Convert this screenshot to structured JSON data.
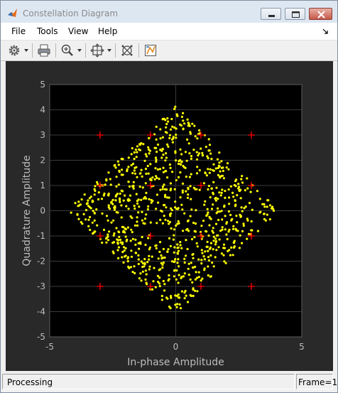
{
  "window": {
    "title": "Constellation Diagram",
    "icons": [
      "matlab-icon",
      "minimize-icon",
      "maximize-icon",
      "close-icon"
    ]
  },
  "menu": {
    "items": [
      "File",
      "Tools",
      "View",
      "Help"
    ]
  },
  "toolbar": {
    "buttons": [
      "gear-icon",
      "print-icon",
      "zoom-in-icon",
      "fit-axes-icon",
      "reference-constellation-icon",
      "measurements-icon"
    ]
  },
  "status": {
    "text": "Processing",
    "frame": "Frame=1"
  },
  "colors": {
    "plot_background": "#000000",
    "figure_background": "#292929",
    "points": "#ffff00",
    "reference": "#ff0000",
    "axis_text": "#bdbdbd"
  },
  "chart_data": {
    "type": "scatter",
    "title": "",
    "xlabel": "In-phase Amplitude",
    "ylabel": "Quadrature Amplitude",
    "xlim": [
      -5,
      5
    ],
    "ylim": [
      -5,
      5
    ],
    "x_ticks": [
      -5,
      0,
      5
    ],
    "y_ticks": [
      -5,
      -4,
      -3,
      -2,
      -1,
      0,
      1,
      2,
      3,
      4,
      5
    ],
    "grid": true,
    "reference_constellation": {
      "name": "16-QAM reference",
      "marker": "+",
      "points": [
        [
          -3,
          3
        ],
        [
          -1,
          3
        ],
        [
          1,
          3
        ],
        [
          3,
          3
        ],
        [
          -3,
          1
        ],
        [
          -1,
          1
        ],
        [
          1,
          1
        ],
        [
          3,
          1
        ],
        [
          -3,
          -1
        ],
        [
          -1,
          -1
        ],
        [
          1,
          -1
        ],
        [
          3,
          -1
        ],
        [
          -3,
          -3
        ],
        [
          -1,
          -3
        ],
        [
          1,
          -3
        ],
        [
          3,
          -3
        ]
      ]
    },
    "received": {
      "count": 900,
      "shape": "diamond",
      "vertices": [
        [
          0,
          4.2
        ],
        [
          4.1,
          0
        ],
        [
          0,
          -4.1
        ],
        [
          -4.3,
          0
        ]
      ]
    }
  }
}
